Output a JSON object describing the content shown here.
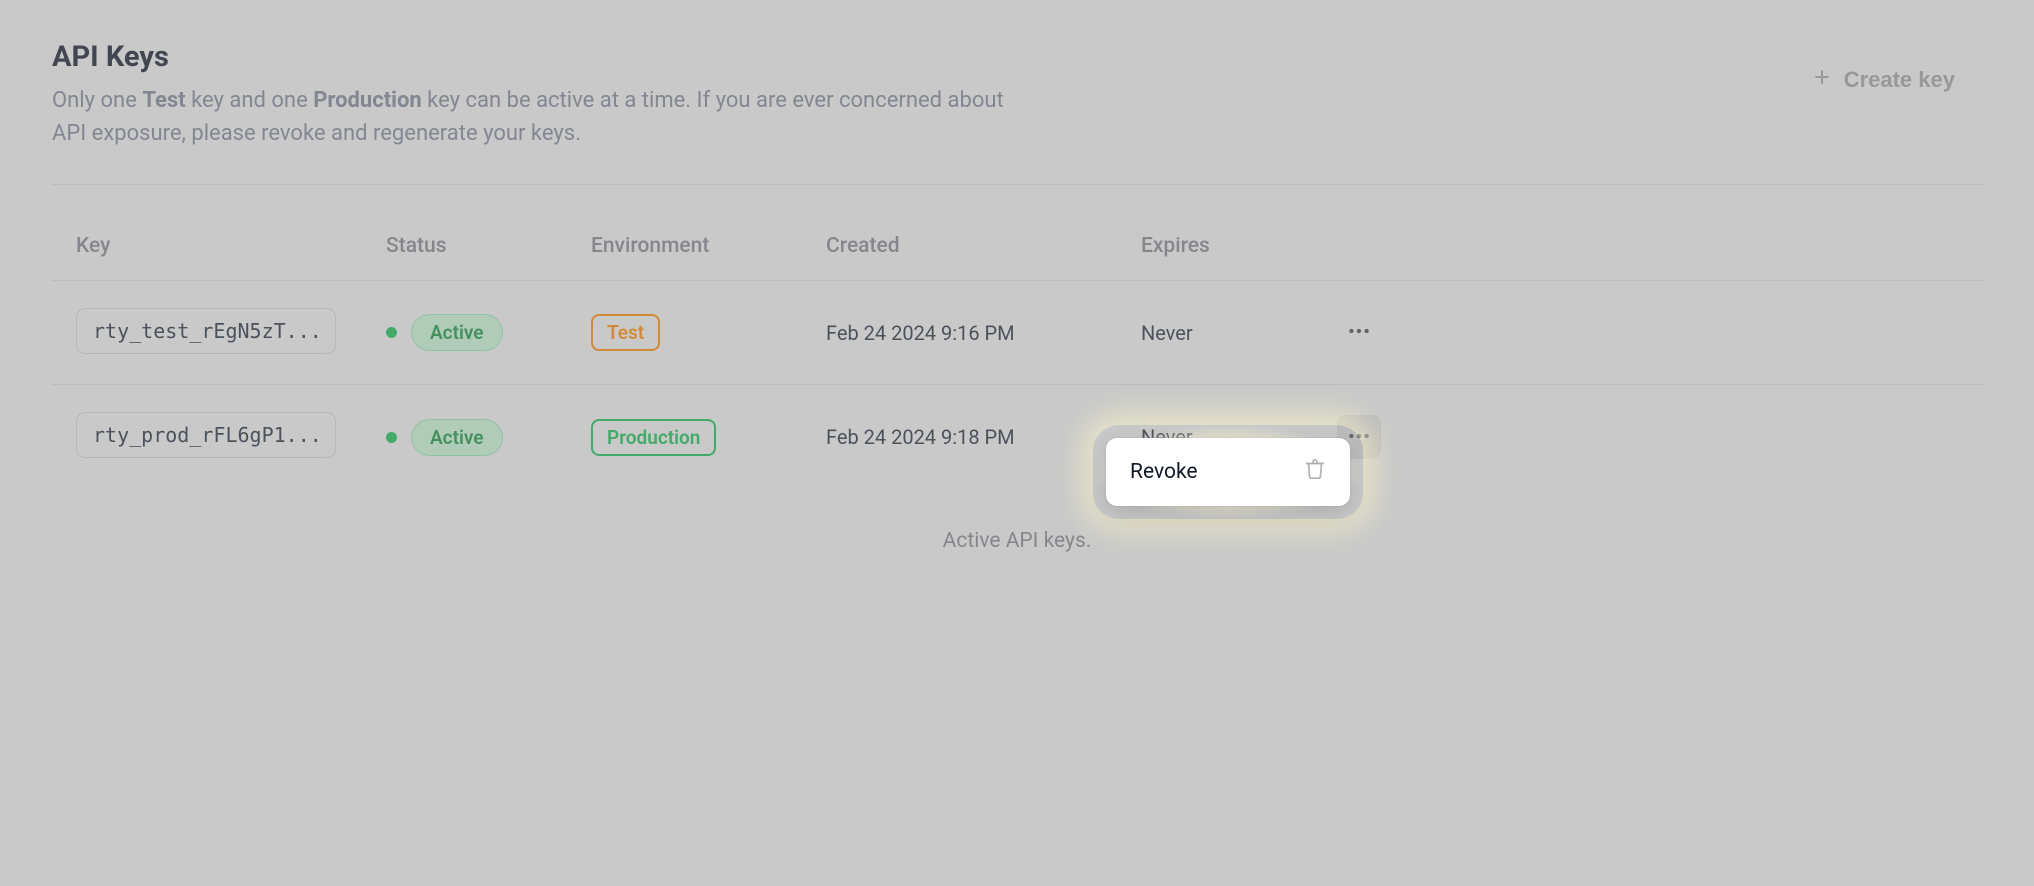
{
  "header": {
    "title": "API Keys",
    "subtitle_pre": "Only one ",
    "subtitle_b1": "Test",
    "subtitle_mid1": " key and one ",
    "subtitle_b2": "Production",
    "subtitle_post": " key can be active at a time. If you are ever concerned about API exposure, please revoke and regenerate your keys.",
    "create_label": "Create key"
  },
  "table": {
    "columns": {
      "key": "Key",
      "status": "Status",
      "environment": "Environment",
      "created": "Created",
      "expires": "Expires"
    },
    "rows": [
      {
        "key_display": "rty_test_rEgN5zT...",
        "status_label": "Active",
        "status_color": "#16a34a",
        "environment_label": "Test",
        "environment_kind": "test",
        "created": "Feb 24 2024 9:16 PM",
        "expires": "Never",
        "menu_open": false
      },
      {
        "key_display": "rty_prod_rFL6gP1...",
        "status_label": "Active",
        "status_color": "#16a34a",
        "environment_label": "Production",
        "environment_kind": "prod",
        "created": "Feb 24 2024 9:18 PM",
        "expires": "Never",
        "menu_open": true
      }
    ],
    "footer_caption": "Active API keys."
  },
  "menu": {
    "items": [
      {
        "label": "Revoke",
        "icon": "trash-icon"
      }
    ]
  }
}
